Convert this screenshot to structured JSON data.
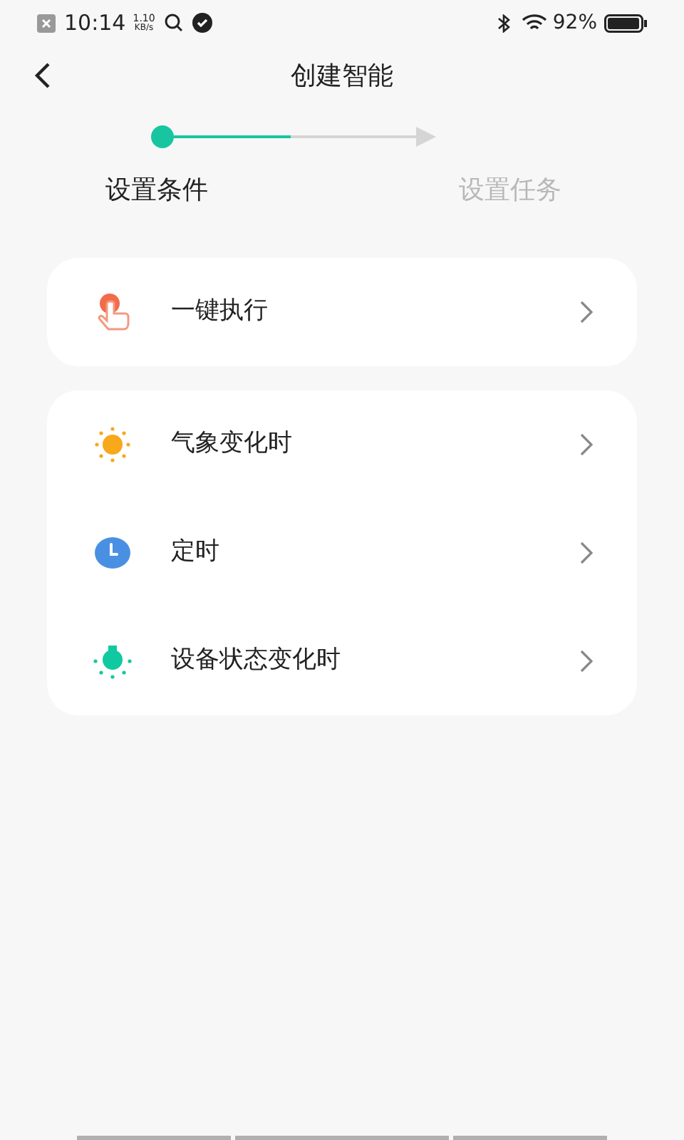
{
  "status_bar": {
    "time": "10:14",
    "net_speed": "1.10",
    "net_unit": "KB/s",
    "battery": "92%"
  },
  "header": {
    "title": "创建智能"
  },
  "stepper": {
    "level": 0.48,
    "steps": [
      {
        "label": "设置条件",
        "selected": true
      },
      {
        "label": "设置任务",
        "selected": false
      }
    ]
  },
  "groups": [
    {
      "items": [
        {
          "kind": "tap",
          "label": "一键执行"
        }
      ]
    },
    {
      "items": [
        {
          "kind": "sun",
          "label": "气象变化时"
        },
        {
          "kind": "clock",
          "label": "定时"
        },
        {
          "kind": "bulb",
          "label": "设备状态变化时"
        }
      ]
    }
  ]
}
